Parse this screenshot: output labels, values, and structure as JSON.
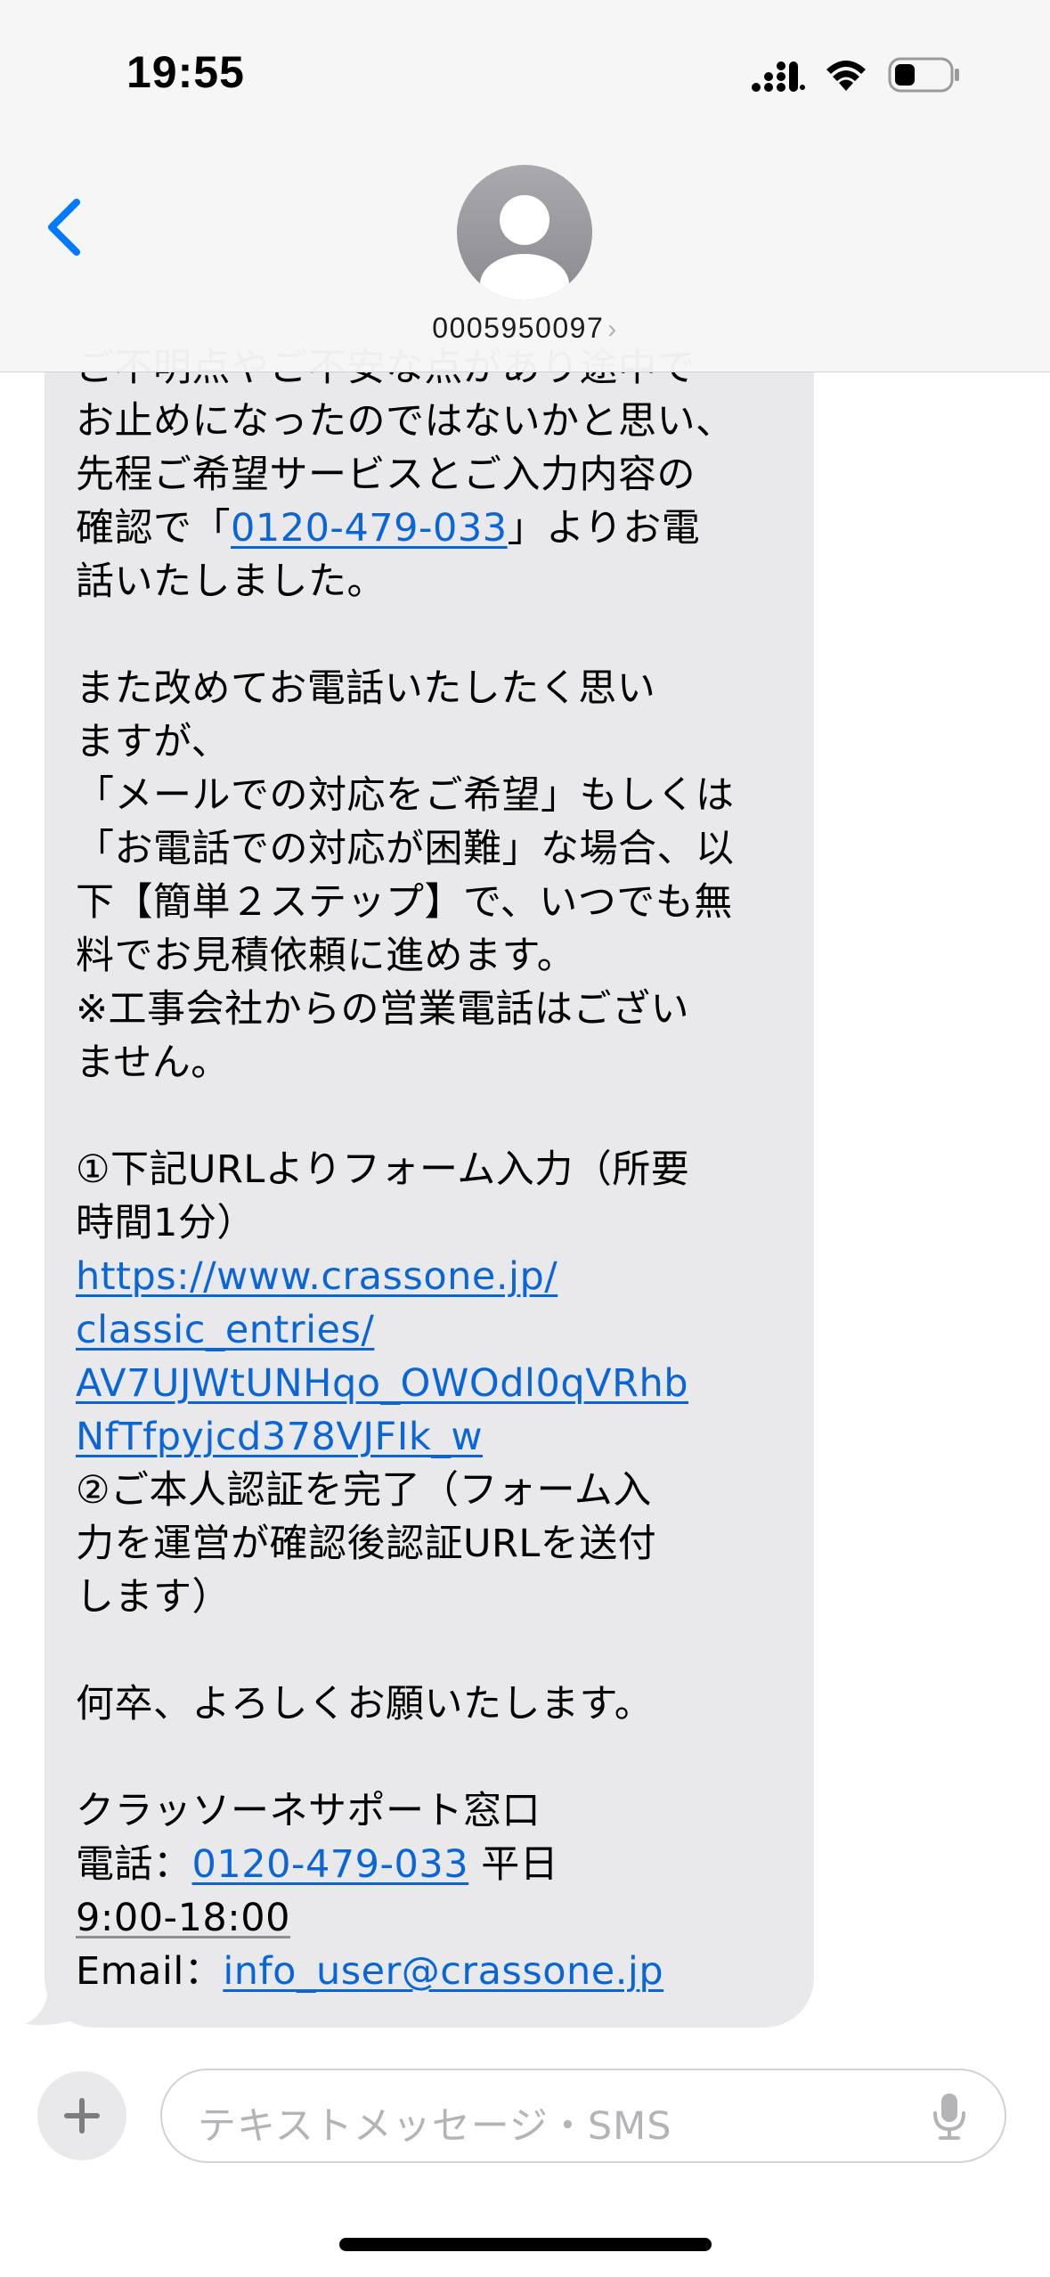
{
  "status_bar": {
    "time": "19:55"
  },
  "header": {
    "contact_name": "0005950097",
    "contact_chevron": "›",
    "back_icon": "chevron-left-icon"
  },
  "message": {
    "lines_a": [
      "ご不明点やご不安な点があり途中で",
      "お止めになったのではないかと思い、",
      "先程ご希望サービスとご入力内容の"
    ],
    "line_call_prefix": "確認で「",
    "phone": "0120-479-033",
    "line_call_suffix": "」よりお電",
    "line_call_end": "話いたしました。",
    "lines_b": [
      "また改めてお電話いたしたく思い",
      "ますが、",
      "「メールでの対応をご希望」もしくは",
      "「お電話での対応が困難」な場合、以",
      "下【簡単２ステップ】で、いつでも無",
      "料でお見積依頼に進めます。",
      "※工事会社からの営業電話はござい",
      "ません。"
    ],
    "step1_lines": [
      "①下記URLよりフォーム入力（所要",
      "時間1分）"
    ],
    "url_lines": [
      "https://www.crassone.jp/",
      "classic_entries/",
      "AV7UJWtUNHqo_OWOdl0qVRhb",
      "NfTfpyjcd378VJFIk_w"
    ],
    "step2_lines": [
      "②ご本人認証を完了（フォーム入",
      "力を運営が確認後認証URLを送付",
      "します）"
    ],
    "closing": "何卒、よろしくお願いたします。",
    "signature": "クラッソーネサポート窓口",
    "tel_prefix": "電話：",
    "tel_number": "0120-479-033",
    "tel_suffix": " 平日",
    "hours": "9:00-18:00",
    "email_prefix": "Email：",
    "email": "info_user@crassone.jp"
  },
  "input_bar": {
    "placeholder": "テキストメッセージ・SMS",
    "plus_icon": "plus-icon",
    "mic_icon": "microphone-icon"
  },
  "colors": {
    "link": "#0a66d6",
    "bubble": "#e9e9eb",
    "accent": "#007aff"
  }
}
